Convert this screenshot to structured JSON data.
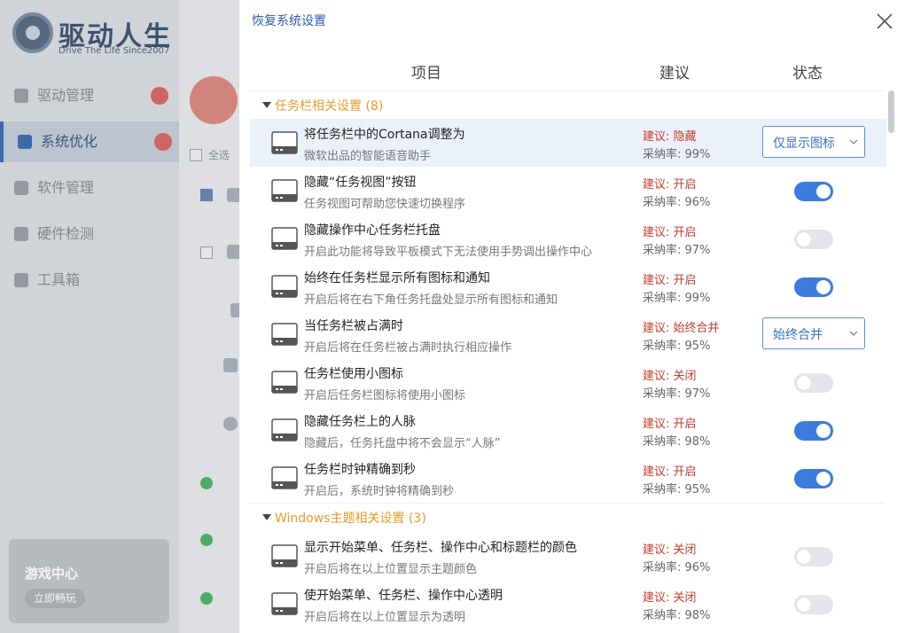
{
  "background": {
    "logo_title": "驱动人生",
    "logo_sub": "Drive The Life  Since2007",
    "nav": [
      {
        "label": "驱动管理",
        "icon": "gear-icon"
      },
      {
        "label": "系统优化",
        "icon": "rocket-icon"
      },
      {
        "label": "软件管理",
        "icon": "cube-icon"
      },
      {
        "label": "硬件检测",
        "icon": "chip-icon"
      },
      {
        "label": "工具箱",
        "icon": "toolbox-icon"
      }
    ],
    "game_center": {
      "title": "游戏中心",
      "button": "立即畅玩"
    },
    "select_all": "全选"
  },
  "panel": {
    "title": "恢复系统设置",
    "headers": {
      "item": "项目",
      "suggest": "建议",
      "status": "状态"
    },
    "groups": [
      {
        "title": "任务栏相关设置 (8)",
        "rows": [
          {
            "title": "将任务栏中的Cortana调整为",
            "desc": "微软出品的智能语音助手",
            "suggest": "建议: 隐藏",
            "rate": "采纳率: 99%",
            "control": "select",
            "value": "仅显示图标"
          },
          {
            "title": "隐藏“任务视图”按钮",
            "desc": "任务视图可帮助您快速切换程序",
            "suggest": "建议: 开启",
            "rate": "采纳率: 96%",
            "control": "toggle",
            "on": true
          },
          {
            "title": "隐藏操作中心任务栏托盘",
            "desc": "开启此功能将导致平板模式下无法使用手势调出操作中心",
            "suggest": "建议: 开启",
            "rate": "采纳率: 97%",
            "control": "toggle",
            "on": false
          },
          {
            "title": "始终在任务栏显示所有图标和通知",
            "desc": "开启后将在右下角任务托盘处显示所有图标和通知",
            "suggest": "建议: 开启",
            "rate": "采纳率: 99%",
            "control": "toggle",
            "on": true
          },
          {
            "title": "当任务栏被占满时",
            "desc": "开启后将在任务栏被占满时执行相应操作",
            "suggest": "建议: 始终合并",
            "rate": "采纳率: 95%",
            "control": "select",
            "value": "始终合并"
          },
          {
            "title": "任务栏使用小图标",
            "desc": "开启后任务栏图标将使用小图标",
            "suggest": "建议: 关闭",
            "rate": "采纳率: 97%",
            "control": "toggle",
            "on": false
          },
          {
            "title": "隐藏任务栏上的人脉",
            "desc": "隐藏后，任务托盘中将不会显示“人脉”",
            "suggest": "建议: 开启",
            "rate": "采纳率: 98%",
            "control": "toggle",
            "on": true
          },
          {
            "title": "任务栏时钟精确到秒",
            "desc": "开启后，系统时钟将精确到秒",
            "suggest": "建议: 开启",
            "rate": "采纳率: 95%",
            "control": "toggle",
            "on": true
          }
        ]
      },
      {
        "title": "Windows主题相关设置 (3)",
        "rows": [
          {
            "title": "显示开始菜单、任务栏、操作中心和标题栏的颜色",
            "desc": "开启后将在以上位置显示主题颜色",
            "suggest": "建议: 关闭",
            "rate": "采纳率: 96%",
            "control": "toggle",
            "on": false
          },
          {
            "title": "使开始菜单、任务栏、操作中心透明",
            "desc": "开启后将在以上位置显示为透明",
            "suggest": "建议: 关闭",
            "rate": "采纳率: 98%",
            "control": "toggle",
            "on": false
          }
        ]
      }
    ],
    "colors": {
      "accent": "#3a7be0",
      "suggest_red": "#c43a2c",
      "group_orange": "#e89a2a",
      "title_blue": "#2f5ea8"
    }
  }
}
